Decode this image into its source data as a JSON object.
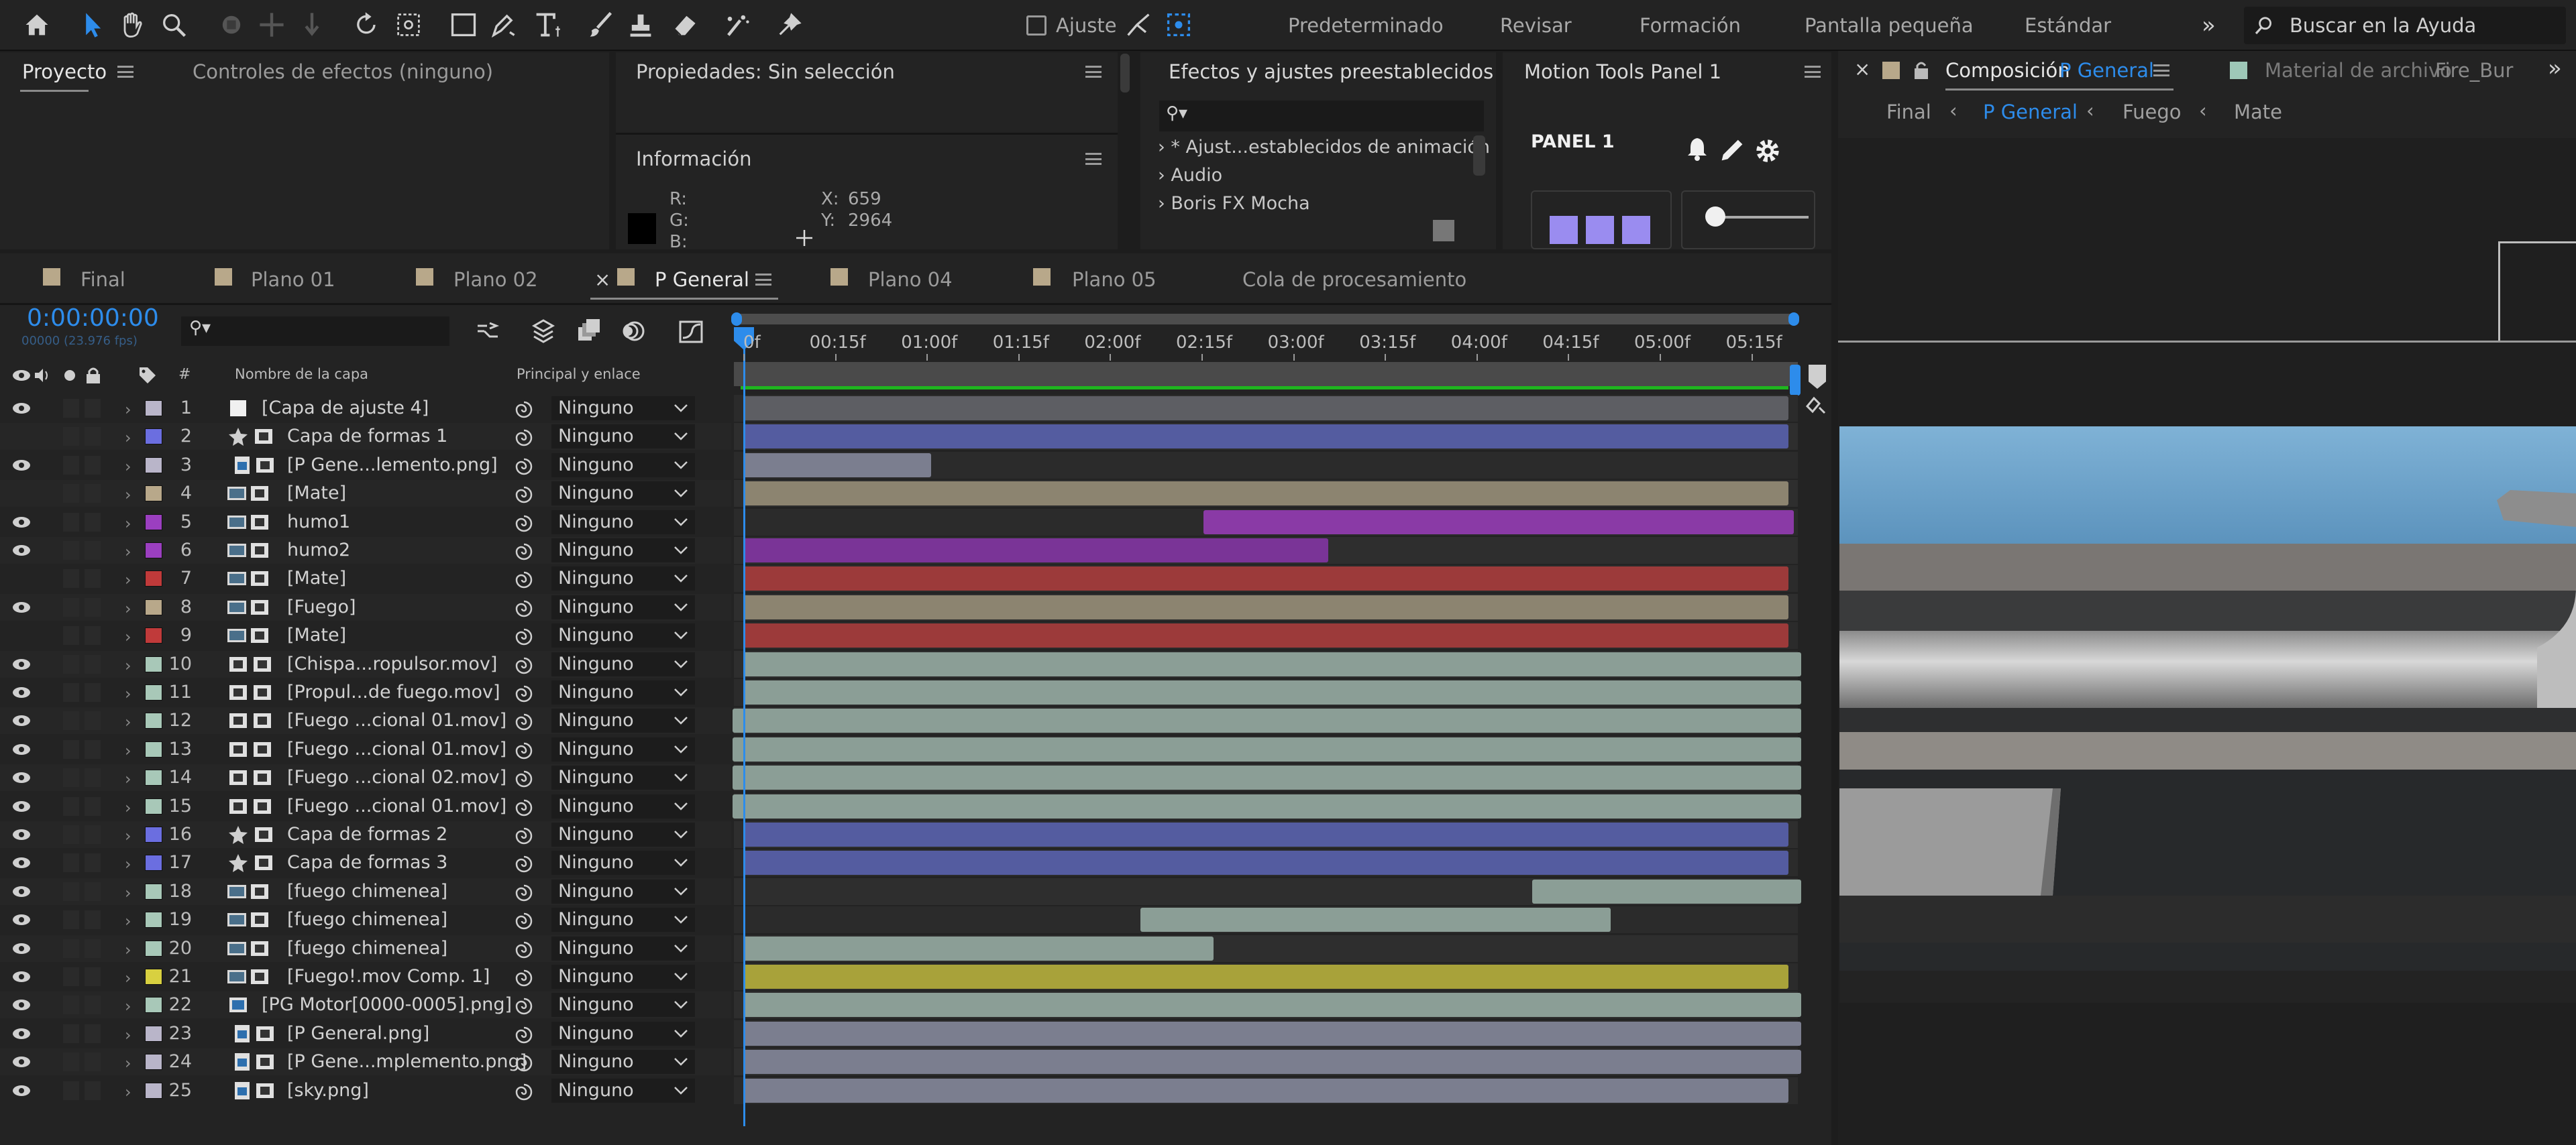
{
  "toolbar": {
    "snap_label": "Ajuste",
    "workspaces": [
      "Predeterminado",
      "Revisar",
      "Formación",
      "Pantalla pequeña",
      "Estándar"
    ],
    "more": "»",
    "help_placeholder": "Buscar en la Ayuda",
    "icons": [
      "home-icon",
      "selection-tool-icon",
      "hand-tool-icon",
      "zoom-tool-icon",
      "orbit-tool-icon",
      "pan-tool-icon",
      "dolly-tool-icon",
      "rotate-tool-icon",
      "anchor-tool-icon",
      "rectangle-tool-icon",
      "pen-tool-icon",
      "text-tool-icon",
      "brush-tool-icon",
      "clone-stamp-icon",
      "eraser-icon",
      "roto-brush-icon",
      "puppet-pin-icon"
    ]
  },
  "project_panel": {
    "tab_project": "Proyecto",
    "tab_effects_controls": "Controles de efectos (ninguno)"
  },
  "properties_panel": {
    "title": "Propiedades: Sin selección",
    "info_title": "Información",
    "r_label": "R:",
    "g_label": "G:",
    "b_label": "B:",
    "x_label": "X:",
    "x_value": "659",
    "y_label": "Y:",
    "y_value": "2964"
  },
  "effects_panel": {
    "title": "Efectos y ajustes preestablecidos",
    "search_glyph": "⚲▾",
    "items": [
      "* Ajust...establecidos de animación",
      "Audio",
      "Boris FX Mocha"
    ]
  },
  "motion_panel": {
    "title": "Motion Tools Panel 1",
    "panel_label": "PANEL 1"
  },
  "composition": {
    "tab_label": "Composición",
    "tab_comp_name": "P General",
    "footage_tab": "Material de archivo",
    "footage_name": "Fire_Bur",
    "breadcrumbs": [
      "Final",
      "P General",
      "Fuego",
      "Mate"
    ],
    "expand": "»"
  },
  "timeline": {
    "tabs": [
      "Final",
      "Plano 01",
      "Plano 02",
      "P General",
      "Plano 04",
      "Plano 05",
      "Cola de procesamiento"
    ],
    "active_tab": "P General",
    "timecode": "0:00:00:00",
    "timecode_sub": "00000 (23.976 fps)",
    "col_number": "#",
    "col_layer_name": "Nombre de la capa",
    "col_parent": "Principal y enlace",
    "ruler": [
      "0f",
      "00:15f",
      "01:00f",
      "01:15f",
      "02:00f",
      "02:15f",
      "03:00f",
      "03:15f",
      "04:00f",
      "04:15f",
      "05:00f",
      "05:15f"
    ],
    "layers": [
      {
        "n": "1",
        "name": "[Capa de ajuste 4]",
        "type": "adjust",
        "color": "#b9b5c9",
        "eye": true,
        "parent": "Ninguno",
        "start": 0,
        "end": 1,
        "bar": "#5d5e63"
      },
      {
        "n": "2",
        "name": "Capa de formas 1",
        "type": "shape",
        "color": "#6b6ee0",
        "eye": false,
        "parent": "Ninguno",
        "start": 0,
        "end": 1,
        "bar": "#545ca0"
      },
      {
        "n": "3",
        "name": "[P Gene...lemento.png]",
        "type": "still",
        "color": "#b9b5c9",
        "eye": true,
        "parent": "Ninguno",
        "start": 0,
        "end": 0.18,
        "bar": "#7b7e8f"
      },
      {
        "n": "4",
        "name": "[Mate]",
        "type": "comp",
        "color": "#b8a88a",
        "eye": false,
        "parent": "Ninguno",
        "start": 0,
        "end": 1,
        "bar": "#8c8470"
      },
      {
        "n": "5",
        "name": "humo1",
        "type": "comp",
        "color": "#9b3fc0",
        "eye": true,
        "parent": "Ninguno",
        "start": 0.44,
        "end": 1.005,
        "bar": "#8a3aa6"
      },
      {
        "n": "6",
        "name": "humo2",
        "type": "comp",
        "color": "#9b3fc0",
        "eye": true,
        "parent": "Ninguno",
        "start": 0,
        "end": 0.56,
        "bar": "#7a3497"
      },
      {
        "n": "7",
        "name": "[Mate]",
        "type": "comp",
        "color": "#c03a3a",
        "eye": false,
        "parent": "Ninguno",
        "start": 0,
        "end": 1,
        "bar": "#9c3a3a"
      },
      {
        "n": "8",
        "name": "[Fuego]",
        "type": "comp",
        "color": "#b8a88a",
        "eye": true,
        "parent": "Ninguno",
        "start": 0,
        "end": 1,
        "bar": "#8c8470"
      },
      {
        "n": "9",
        "name": "[Mate]",
        "type": "comp",
        "color": "#c03a3a",
        "eye": false,
        "parent": "Ninguno",
        "start": 0,
        "end": 1,
        "bar": "#9c3a3a"
      },
      {
        "n": "10",
        "name": "[Chispa...ropulsor.mov]",
        "type": "movie",
        "color": "#a8c8b8",
        "eye": true,
        "parent": "Ninguno",
        "start": 0,
        "end": 1.012,
        "bar": "#8b9e96"
      },
      {
        "n": "11",
        "name": "[Propul...de fuego.mov]",
        "type": "movie",
        "color": "#a8c8b8",
        "eye": true,
        "parent": "Ninguno",
        "start": 0,
        "end": 1.012,
        "bar": "#8b9e96"
      },
      {
        "n": "12",
        "name": "[Fuego ...cional 01.mov]",
        "type": "movie",
        "color": "#a8c8b8",
        "eye": true,
        "parent": "Ninguno",
        "start": -0.01,
        "end": 1.012,
        "bar": "#8b9e96"
      },
      {
        "n": "13",
        "name": "[Fuego ...cional 01.mov]",
        "type": "movie",
        "color": "#a8c8b8",
        "eye": true,
        "parent": "Ninguno",
        "start": -0.01,
        "end": 1.012,
        "bar": "#8b9e96"
      },
      {
        "n": "14",
        "name": "[Fuego ...cional 02.mov]",
        "type": "movie",
        "color": "#a8c8b8",
        "eye": true,
        "parent": "Ninguno",
        "start": -0.01,
        "end": 1.012,
        "bar": "#8b9e96"
      },
      {
        "n": "15",
        "name": "[Fuego ...cional 01.mov]",
        "type": "movie",
        "color": "#a8c8b8",
        "eye": true,
        "parent": "Ninguno",
        "start": -0.01,
        "end": 1.012,
        "bar": "#8b9e96"
      },
      {
        "n": "16",
        "name": "Capa de formas 2",
        "type": "shape",
        "color": "#6b6ee0",
        "eye": true,
        "parent": "Ninguno",
        "start": 0,
        "end": 1,
        "bar": "#545ca0"
      },
      {
        "n": "17",
        "name": "Capa de formas 3",
        "type": "shape",
        "color": "#6b6ee0",
        "eye": true,
        "parent": "Ninguno",
        "start": 0,
        "end": 1,
        "bar": "#545ca0"
      },
      {
        "n": "18",
        "name": "[fuego chimenea]",
        "type": "comp",
        "color": "#a8c8b8",
        "eye": true,
        "parent": "Ninguno",
        "start": 0.755,
        "end": 1.012,
        "bar": "#8b9e96"
      },
      {
        "n": "19",
        "name": "[fuego chimenea]",
        "type": "comp",
        "color": "#a8c8b8",
        "eye": true,
        "parent": "Ninguno",
        "start": 0.38,
        "end": 0.83,
        "bar": "#8b9e96"
      },
      {
        "n": "20",
        "name": "[fuego chimenea]",
        "type": "comp",
        "color": "#a8c8b8",
        "eye": true,
        "parent": "Ninguno",
        "start": 0,
        "end": 0.45,
        "bar": "#8b9e96"
      },
      {
        "n": "21",
        "name": "[Fuego!.mov Comp. 1]",
        "type": "comp",
        "color": "#d8d040",
        "eye": true,
        "parent": "Ninguno",
        "start": 0,
        "end": 1,
        "bar": "#a8a23a"
      },
      {
        "n": "22",
        "name": "[PG Motor[0000-0005].png]",
        "type": "seq",
        "color": "#a8c8b8",
        "eye": true,
        "parent": "Ninguno",
        "start": 0,
        "end": 1.012,
        "bar": "#8b9e96"
      },
      {
        "n": "23",
        "name": "[P General.png]",
        "type": "still",
        "color": "#b9b5c9",
        "eye": true,
        "parent": "Ninguno",
        "start": 0,
        "end": 1.012,
        "bar": "#7b7e8f"
      },
      {
        "n": "24",
        "name": "[P Gene...mplemento.png]",
        "type": "still",
        "color": "#b9b5c9",
        "eye": true,
        "parent": "Ninguno",
        "start": 0,
        "end": 1.012,
        "bar": "#7b7e8f"
      },
      {
        "n": "25",
        "name": "[sky.png]",
        "type": "still",
        "color": "#b9b5c9",
        "eye": true,
        "parent": "Ninguno",
        "start": 0,
        "end": 1,
        "bar": "#7b7e8f"
      }
    ]
  },
  "colors": {
    "accent": "#2d8ceb",
    "work_area": "#1fb51f",
    "panel_bg": "#232323"
  }
}
